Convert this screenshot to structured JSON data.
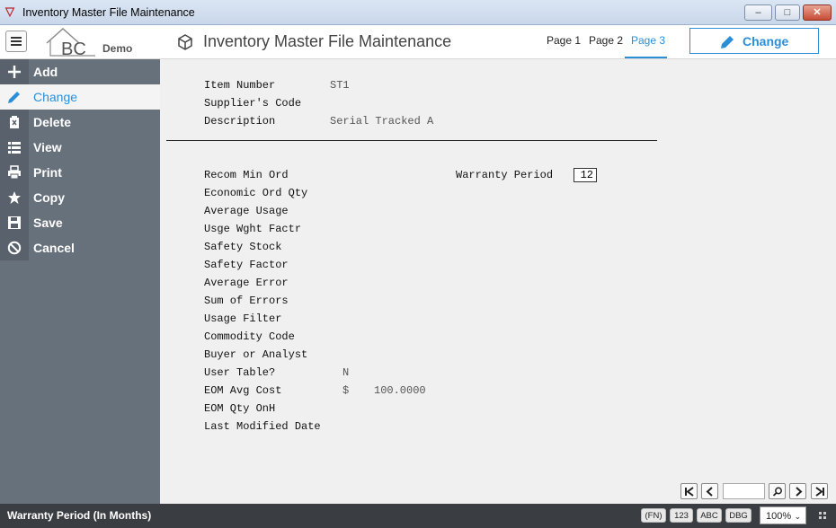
{
  "window": {
    "title": "Inventory Master File Maintenance",
    "controls": {
      "minimize": "‒",
      "maximize": "□",
      "close": "✕"
    }
  },
  "header": {
    "logo_text": "BC",
    "logo_sub": "Demo",
    "page_title": "Inventory Master File Maintenance",
    "tabs": [
      {
        "label": "Page 1",
        "active": false
      },
      {
        "label": "Page 2",
        "active": false
      },
      {
        "label": "Page 3",
        "active": true
      }
    ],
    "mode_button": "Change",
    "accent_color": "#2b8fd8"
  },
  "sidebar": {
    "items": [
      {
        "label": "Add",
        "icon": "plus-icon",
        "active": false
      },
      {
        "label": "Change",
        "icon": "pencil-icon",
        "active": true
      },
      {
        "label": "Delete",
        "icon": "trash-icon",
        "active": false
      },
      {
        "label": "View",
        "icon": "list-icon",
        "active": false
      },
      {
        "label": "Print",
        "icon": "printer-icon",
        "active": false
      },
      {
        "label": "Copy",
        "icon": "star-icon",
        "active": false
      },
      {
        "label": "Save",
        "icon": "floppy-icon",
        "active": false
      },
      {
        "label": "Cancel",
        "icon": "cancel-icon",
        "active": false
      }
    ]
  },
  "form": {
    "header_fields": [
      {
        "label": "Item Number",
        "value": "ST1"
      },
      {
        "label": "Supplier's Code",
        "value": ""
      },
      {
        "label": "Description",
        "value": "Serial Tracked A"
      }
    ],
    "fields": [
      {
        "label": "Recom Min Ord",
        "value": ""
      },
      {
        "label": "Economic Ord Qty",
        "value": ""
      },
      {
        "label": "Average Usage",
        "value": ""
      },
      {
        "label": "Usge Wght Factr",
        "value": ""
      },
      {
        "label": "Safety Stock",
        "value": ""
      },
      {
        "label": "Safety Factor",
        "value": ""
      },
      {
        "label": "Average Error",
        "value": ""
      },
      {
        "label": "Sum of Errors",
        "value": ""
      },
      {
        "label": "Usage Filter",
        "value": ""
      },
      {
        "label": "Commodity Code",
        "value": ""
      },
      {
        "label": "Buyer or Analyst",
        "value": ""
      },
      {
        "label": "User Table?",
        "value": "N"
      },
      {
        "label": "EOM Avg Cost",
        "currency": "$",
        "value": "100.0000"
      },
      {
        "label": "EOM Qty OnH",
        "value": ""
      },
      {
        "label": "Last Modified Date",
        "value": ""
      }
    ],
    "warranty": {
      "label": "Warranty Period",
      "value": "12"
    }
  },
  "navigator": {
    "buttons": [
      "first-record-icon",
      "previous-record-icon",
      "search-icon",
      "next-record-icon",
      "last-record-icon"
    ],
    "record_input": ""
  },
  "status": {
    "text": "Warranty Period (In Months)",
    "pills": [
      "(FN)",
      "123",
      "ABC",
      "DBG"
    ],
    "zoom": "100%"
  }
}
